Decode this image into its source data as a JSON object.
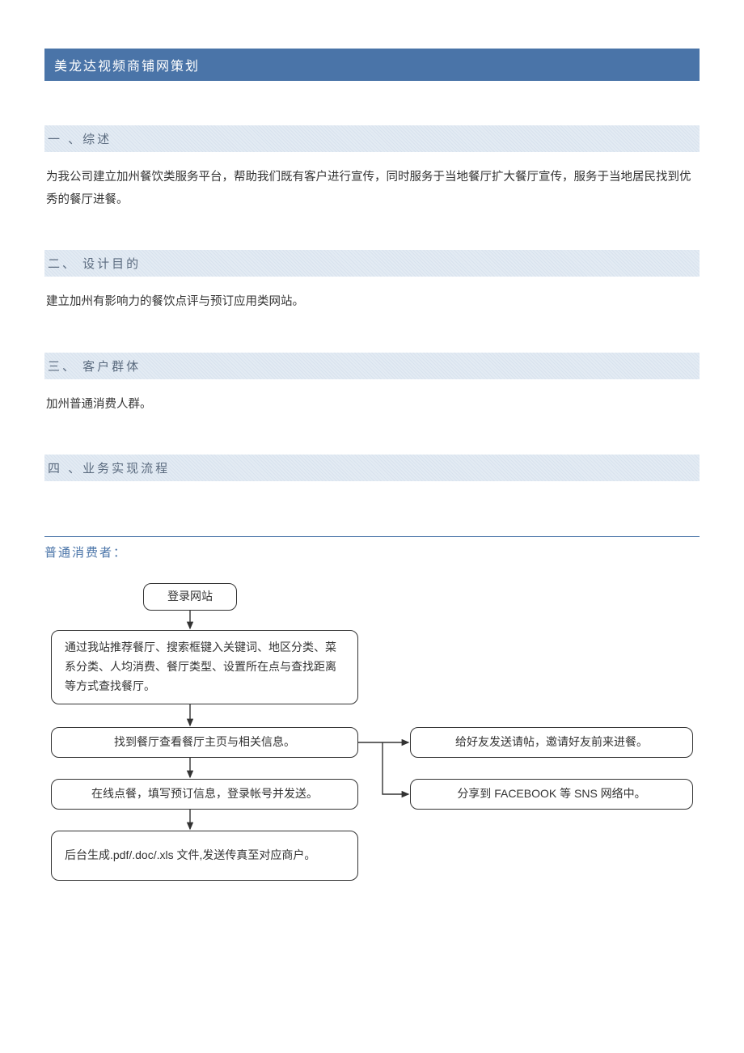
{
  "title": "美龙达视频商铺网策划",
  "sections": [
    {
      "header": "一 、综述",
      "body": "为我公司建立加州餐饮类服务平台，帮助我们既有客户进行宣传，同时服务于当地餐厅扩大餐厅宣传，服务于当地居民找到优秀的餐厅进餐。"
    },
    {
      "header": "二、 设计目的",
      "body": "建立加州有影响力的餐饮点评与预订应用类网站。"
    },
    {
      "header": "三、 客户群体",
      "body": "加州普通消费人群。"
    },
    {
      "header": "四 、业务实现流程",
      "body": ""
    }
  ],
  "sub_title": "普通消费者：",
  "flow": {
    "n1": "登录网站",
    "n2": "通过我站推荐餐厅、搜索框键入关键词、地区分类、菜系分类、人均消费、餐厅类型、设置所在点与查找距离等方式查找餐厅。",
    "n3": "找到餐厅查看餐厅主页与相关信息。",
    "n4": "在线点餐，填写预订信息，登录帐号并发送。",
    "n5": "后台生成.pdf/.doc/.xls 文件,发送传真至对应商户。",
    "r1": "给好友发送请帖，邀请好友前来进餐。",
    "r2": "分享到 FACEBOOK 等 SNS 网络中。"
  }
}
